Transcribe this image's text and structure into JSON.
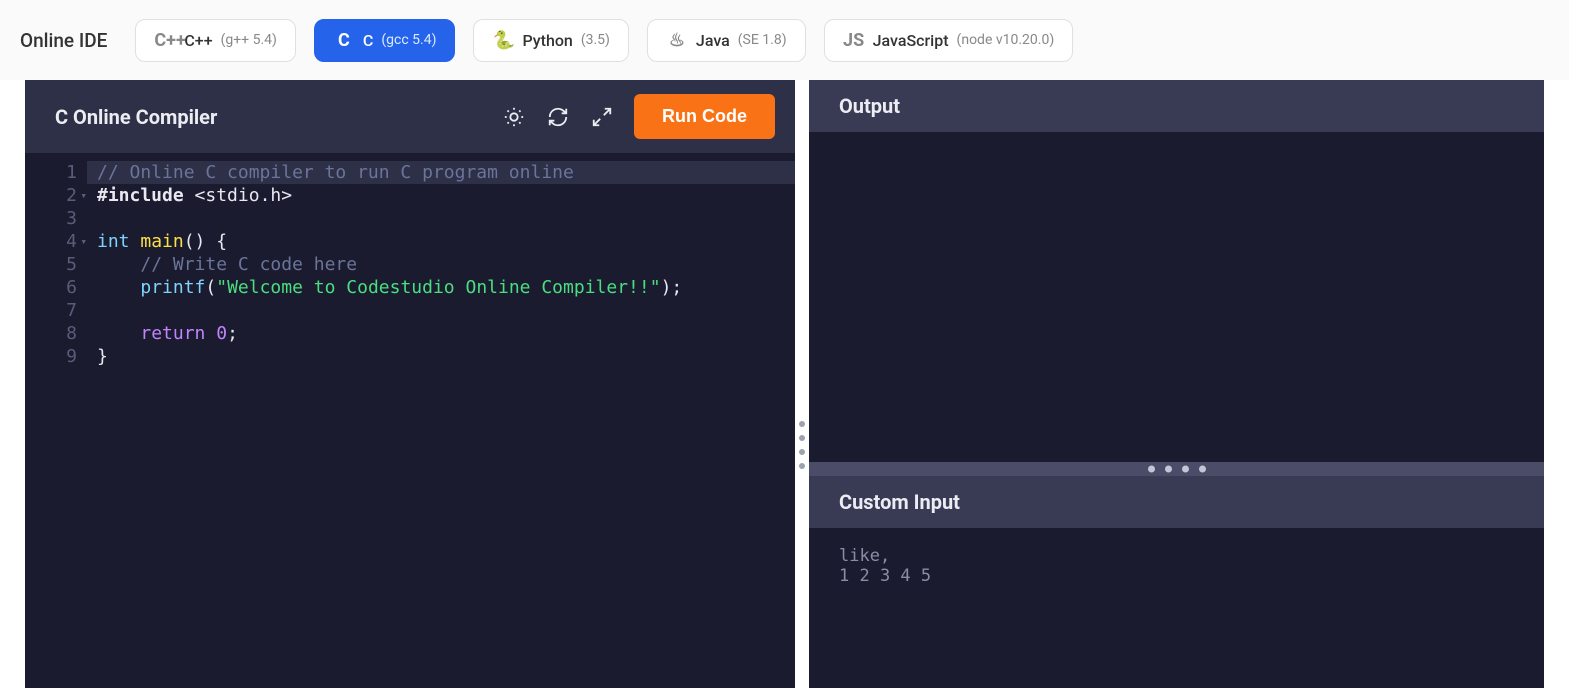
{
  "brand": "Online IDE",
  "languages": [
    {
      "icon": "C++",
      "name": "C++",
      "version": "(g++ 5.4)",
      "active": false
    },
    {
      "icon": "C",
      "name": "C",
      "version": "(gcc 5.4)",
      "active": true
    },
    {
      "icon": "🐍",
      "name": "Python",
      "version": "(3.5)",
      "active": false
    },
    {
      "icon": "♨",
      "name": "Java",
      "version": "(SE 1.8)",
      "active": false
    },
    {
      "icon": "JS",
      "name": "JavaScript",
      "version": "(node v10.20.0)",
      "active": false
    }
  ],
  "editor": {
    "title": "C Online Compiler",
    "run_label": "Run Code",
    "lines": [
      {
        "n": 1,
        "fold": false,
        "hl": true,
        "tokens": [
          {
            "c": "tok-comment",
            "t": "// Online C compiler to run C program online"
          }
        ]
      },
      {
        "n": 2,
        "fold": true,
        "hl": false,
        "tokens": [
          {
            "c": "tok-preproc",
            "t": "#include"
          },
          {
            "c": "",
            "t": " "
          },
          {
            "c": "tok-include",
            "t": "<stdio.h>"
          }
        ]
      },
      {
        "n": 3,
        "fold": false,
        "hl": false,
        "tokens": []
      },
      {
        "n": 4,
        "fold": true,
        "hl": false,
        "tokens": [
          {
            "c": "tok-type",
            "t": "int"
          },
          {
            "c": "",
            "t": " "
          },
          {
            "c": "tok-func",
            "t": "main"
          },
          {
            "c": "tok-punc",
            "t": "() {"
          }
        ]
      },
      {
        "n": 5,
        "fold": false,
        "hl": false,
        "tokens": [
          {
            "c": "",
            "t": "    "
          },
          {
            "c": "tok-comment",
            "t": "// Write C code here"
          }
        ]
      },
      {
        "n": 6,
        "fold": false,
        "hl": false,
        "tokens": [
          {
            "c": "",
            "t": "    "
          },
          {
            "c": "tok-call",
            "t": "printf"
          },
          {
            "c": "tok-punc",
            "t": "("
          },
          {
            "c": "tok-str",
            "t": "\"Welcome to Codestudio Online Compiler!!\""
          },
          {
            "c": "tok-punc",
            "t": ");"
          }
        ]
      },
      {
        "n": 7,
        "fold": false,
        "hl": false,
        "tokens": []
      },
      {
        "n": 8,
        "fold": false,
        "hl": false,
        "tokens": [
          {
            "c": "",
            "t": "    "
          },
          {
            "c": "tok-kw",
            "t": "return"
          },
          {
            "c": "",
            "t": " "
          },
          {
            "c": "tok-num",
            "t": "0"
          },
          {
            "c": "tok-punc",
            "t": ";"
          }
        ]
      },
      {
        "n": 9,
        "fold": false,
        "hl": false,
        "tokens": [
          {
            "c": "tok-punc",
            "t": "}"
          }
        ]
      }
    ]
  },
  "output": {
    "title": "Output",
    "content": ""
  },
  "custom_input": {
    "title": "Custom Input",
    "content": "like,\n1 2 3 4 5"
  }
}
